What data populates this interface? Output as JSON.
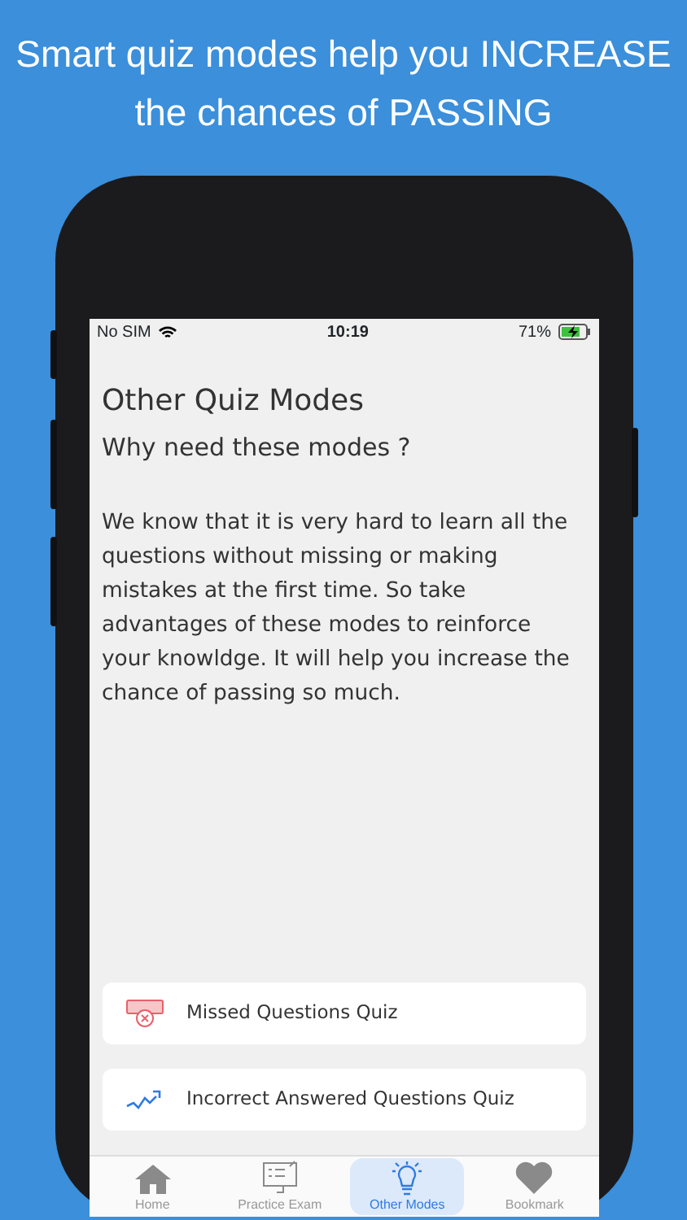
{
  "headline": "Smart quiz modes help you INCREASE the chances of PASSING",
  "status_bar": {
    "carrier": "No SIM",
    "time": "10:19",
    "battery": "71%",
    "charging": true
  },
  "title": "Other Quiz Modes",
  "subtitle": "Why need these modes ?",
  "description": "We know that it is very hard to learn all the questions without missing or making mistakes at the first time. So take advantages of these modes to reinforce your knowldge. It will help you increase the chance of passing so much.",
  "modes": [
    {
      "label": "Missed Questions Quiz",
      "kind": "missed"
    },
    {
      "label": "Incorrect Answered Questions Quiz",
      "kind": "incorrect"
    }
  ],
  "tabs": [
    {
      "label": "Home",
      "kind": "home",
      "selected": false
    },
    {
      "label": "Practice Exam",
      "kind": "exam",
      "selected": false
    },
    {
      "label": "Other Modes",
      "kind": "modes",
      "selected": true
    },
    {
      "label": "Bookmark",
      "kind": "bookmark",
      "selected": false
    }
  ]
}
